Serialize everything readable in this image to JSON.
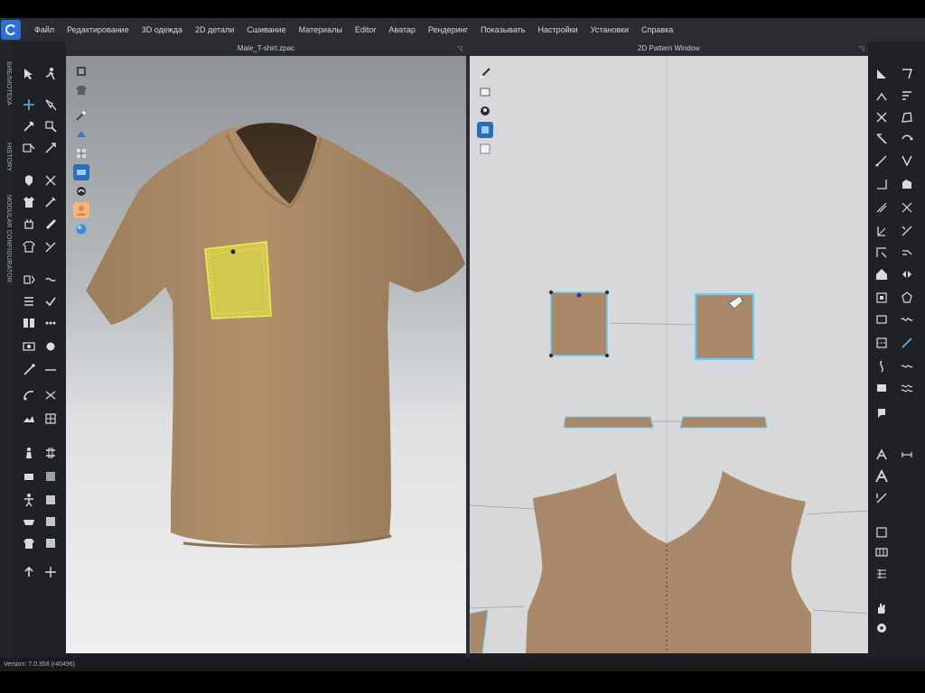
{
  "menu": [
    "Файл",
    "Редактирование",
    "3D одежда",
    "2D детали",
    "Сшивание",
    "Материалы",
    "Editor",
    "Аватар",
    "Рендеринг",
    "Показывать",
    "Настройки",
    "Установки",
    "Справка"
  ],
  "left_tabs": [
    "БИБЛИОТЕКА",
    "HISTORY",
    "MODULAR CONFIGURATOR"
  ],
  "viewport3d": {
    "title": "Male_T-shirt.zpac"
  },
  "viewport2d": {
    "title": "2D Pattern Window"
  },
  "status": {
    "version": "Version: 7.0.358 (r40496)"
  },
  "colors": {
    "fabric": "#ad8c66",
    "fabric_2d": "#a9896a",
    "selected_piece": "#d8d24a",
    "selection_outline": "#6fc8f0",
    "accent": "#2d6fd6"
  }
}
